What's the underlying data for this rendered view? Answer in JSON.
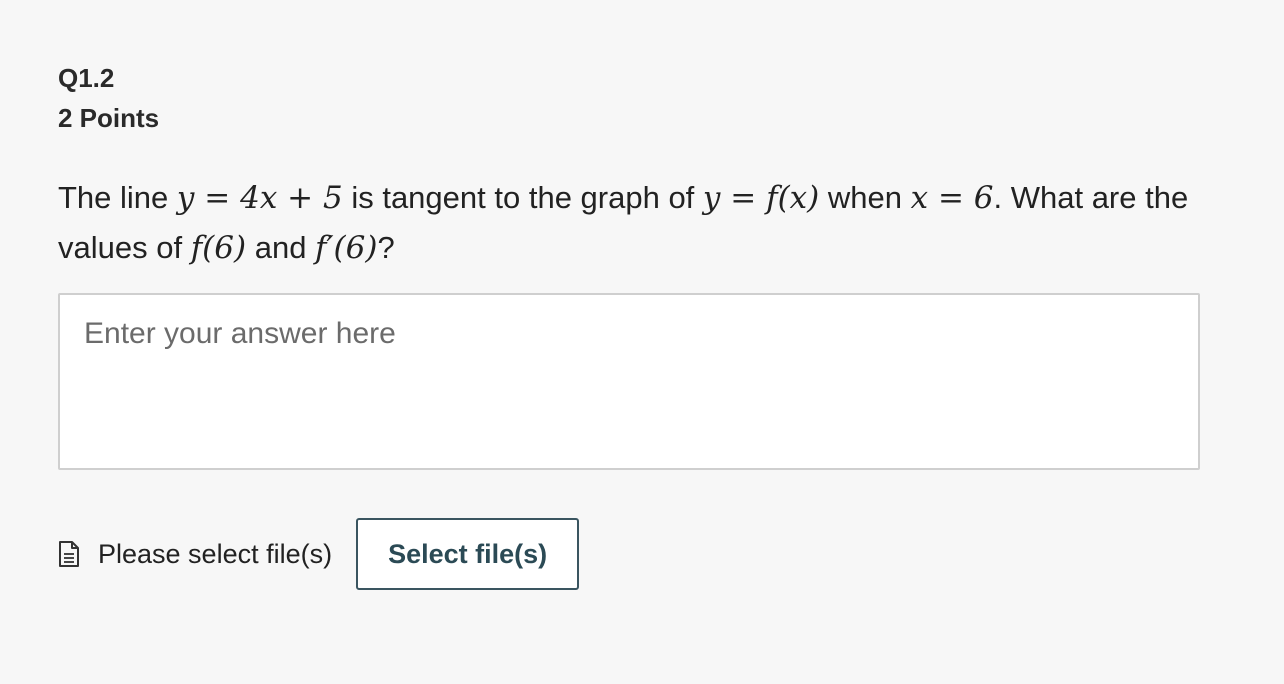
{
  "question": {
    "id": "Q1.2",
    "points": "2 Points",
    "prompt": {
      "t1": "The line ",
      "m1": "y = 4x + 5",
      "t2": " is tangent to the graph of ",
      "m2": "y = f(x)",
      "t3": " when ",
      "m3": "x = 6",
      "t4": ". What are the values of ",
      "m4": "f(6)",
      "t5": " and ",
      "m5": "f′(6)",
      "t6": "?"
    }
  },
  "answer": {
    "placeholder": "Enter your answer here",
    "value": ""
  },
  "upload": {
    "status_label": "Please select file(s)",
    "button_label": "Select file(s)",
    "icon": "file-icon"
  },
  "colors": {
    "background": "#f7f7f7",
    "button_border": "#3a5560",
    "button_text": "#2b4a55",
    "input_border": "#cfcfcf"
  }
}
